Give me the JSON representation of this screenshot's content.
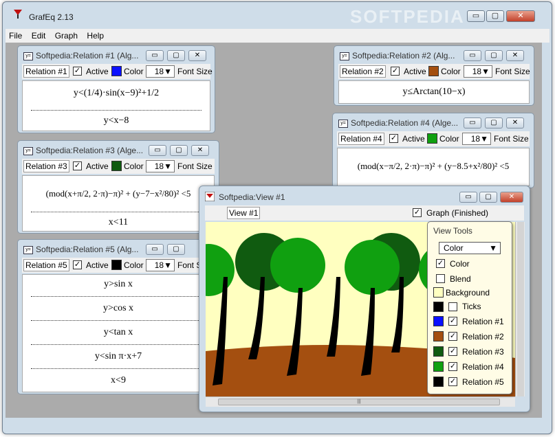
{
  "app": {
    "title": "GrafEq 2.13",
    "watermark": "SOFTPEDIA",
    "menu": [
      "File",
      "Edit",
      "Graph",
      "Help"
    ]
  },
  "common": {
    "active_label": "Active",
    "color_label": "Color",
    "font_size_label": "Font Size",
    "font_size_value": "18",
    "check_mark": "✓",
    "min_glyph": "▭",
    "max_glyph": "▢",
    "close_glyph": "✕"
  },
  "relations": [
    {
      "title": "Softpedia:Relation #1 (Alg...",
      "name": "Relation #1",
      "color": "#0a10ff",
      "eq": [
        "y<(1/4)·sin(x−9)²+1/2",
        "y<x−8"
      ]
    },
    {
      "title": "Softpedia:Relation #2 (Alg...",
      "name": "Relation #2",
      "color": "#a44f10",
      "eq": [
        "y≤Arctan(10−x)"
      ]
    },
    {
      "title": "Softpedia:Relation #3 (Alge...",
      "name": "Relation #3",
      "color": "#105b10",
      "eq": [
        "(mod(x+π/2, 2·π)−π)² + (y−7−x²/80)² <5",
        "x<11"
      ]
    },
    {
      "title": "Softpedia:Relation #4 (Alge...",
      "name": "Relation #4",
      "color": "#10a010",
      "eq": [
        "(mod(x−π/2, 2·π)−π)² + (y−8.5+x²/80)² <5"
      ]
    },
    {
      "title": "Softpedia:Relation #5 (Alg...",
      "name": "Relation #5",
      "color": "#000000",
      "eq": [
        "y>sin x",
        "y>cos x",
        "y<tan x",
        "y<sin π·x+7",
        "x<9"
      ]
    }
  ],
  "view": {
    "title": "Softpedia:View #1",
    "name": "View #1",
    "graph_label": "Graph (Finished)",
    "background": "#ffffc0",
    "tools": {
      "title": "View Tools",
      "mode": "Color",
      "color_label": "Color",
      "blend_label": "Blend",
      "background_label": "Background",
      "ticks_label": "Ticks",
      "items": [
        {
          "label": "Relation #1",
          "color": "#0a10ff"
        },
        {
          "label": "Relation #2",
          "color": "#a44f10"
        },
        {
          "label": "Relation #3",
          "color": "#105b10"
        },
        {
          "label": "Relation #4",
          "color": "#10a010"
        },
        {
          "label": "Relation #5",
          "color": "#000000"
        }
      ]
    }
  }
}
